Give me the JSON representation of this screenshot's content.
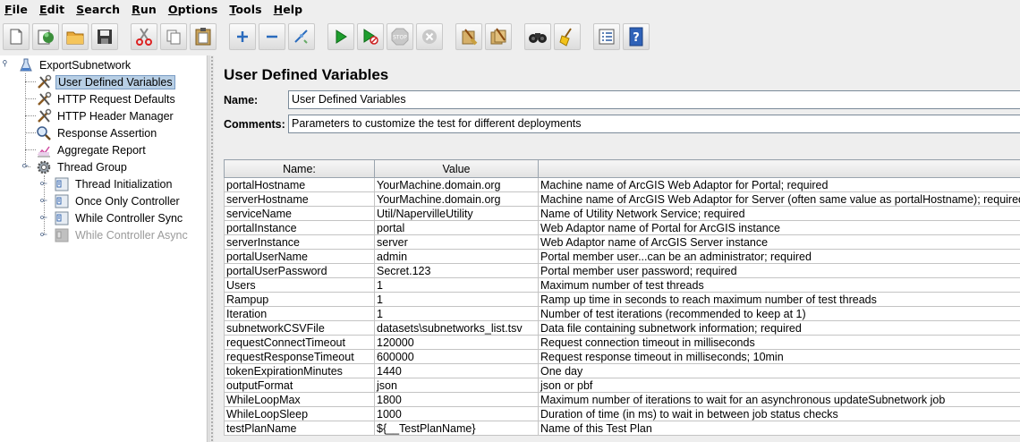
{
  "menu": {
    "file": {
      "u": "F",
      "rest": "ile"
    },
    "edit": {
      "u": "E",
      "rest": "dit"
    },
    "search": {
      "u": "S",
      "rest": "earch"
    },
    "run": {
      "u": "R",
      "rest": "un"
    },
    "options": {
      "u": "O",
      "rest": "ptions"
    },
    "tools": {
      "u": "T",
      "rest": "ools"
    },
    "help": {
      "u": "H",
      "rest": "elp"
    }
  },
  "toolbar": {
    "icons": [
      "new-file-icon",
      "templates-icon",
      "open-folder-icon",
      "save-icon",
      "cut-icon",
      "copy-icon",
      "paste-icon",
      "expand-plus-icon",
      "collapse-minus-icon",
      "toggle-icon",
      "start-play-icon",
      "start-no-pauses-icon",
      "stop-icon",
      "shutdown-icon",
      "clear-icon",
      "clear-all-icon",
      "search-binoculars-icon",
      "reset-search-broom-icon",
      "function-helper-icon",
      "help-icon"
    ]
  },
  "tree": {
    "root": "ExportSubnetwork",
    "items": [
      {
        "label": "User Defined Variables",
        "icon": "wrench-icon"
      },
      {
        "label": "HTTP Request Defaults",
        "icon": "wrench-icon"
      },
      {
        "label": "HTTP Header Manager",
        "icon": "wrench-icon"
      },
      {
        "label": "Response Assertion",
        "icon": "magnifier-icon"
      },
      {
        "label": "Aggregate Report",
        "icon": "chart-icon"
      },
      {
        "label": "Thread Group",
        "icon": "gear-icon"
      },
      {
        "label": "Thread Initialization",
        "icon": "controller-icon"
      },
      {
        "label": "Once Only Controller",
        "icon": "controller-icon"
      },
      {
        "label": "While Controller Sync",
        "icon": "controller-icon"
      },
      {
        "label": "While Controller Async",
        "icon": "controller-icon"
      }
    ]
  },
  "panel": {
    "title": "User Defined Variables",
    "name_label": "Name:",
    "name_value": "User Defined Variables",
    "comments_label": "Comments:",
    "comments_value": "Parameters to customize the test for different deployments"
  },
  "table": {
    "headers": [
      "Name:",
      "Value",
      ""
    ],
    "rows": [
      [
        "portalHostname",
        "YourMachine.domain.org",
        "Machine name of ArcGIS Web Adaptor for Portal; required"
      ],
      [
        "serverHostname",
        "YourMachine.domain.org",
        "Machine name of ArcGIS Web Adaptor for Server (often same value as portalHostname); required"
      ],
      [
        "serviceName",
        "Util/NapervilleUtility",
        "Name of Utility Network Service; required"
      ],
      [
        "portalInstance",
        "portal",
        "Web Adaptor name of Portal for ArcGIS instance"
      ],
      [
        "serverInstance",
        "server",
        "Web Adaptor name of ArcGIS Server instance"
      ],
      [
        "portalUserName",
        "admin",
        "Portal member user...can be an administrator; required"
      ],
      [
        "portalUserPassword",
        "Secret.123",
        "Portal member user password; required"
      ],
      [
        "Users",
        "1",
        "Maximum number of test threads"
      ],
      [
        "Rampup",
        "1",
        "Ramp up time in seconds to reach maximum number of test threads"
      ],
      [
        "Iteration",
        "1",
        "Number of test iterations (recommended to keep at 1)"
      ],
      [
        "subnetworkCSVFile",
        "datasets\\subnetworks_list.tsv",
        "Data file containing subnetwork information; required"
      ],
      [
        "requestConnectTimeout",
        "120000",
        "Request connection timeout in milliseconds"
      ],
      [
        "requestResponseTimeout",
        "600000",
        "Request response timeout in milliseconds; 10min"
      ],
      [
        "tokenExpirationMinutes",
        "1440",
        "One day"
      ],
      [
        "outputFormat",
        "json",
        "json or pbf"
      ],
      [
        "WhileLoopMax",
        "1800",
        "Maximum number of iterations to wait for an asynchronous updateSubnetwork job"
      ],
      [
        "WhileLoopSleep",
        "1000",
        "Duration of time (in ms) to wait in between job status checks"
      ],
      [
        "testPlanName",
        "${__TestPlanName}",
        "Name of this Test Plan"
      ]
    ]
  }
}
